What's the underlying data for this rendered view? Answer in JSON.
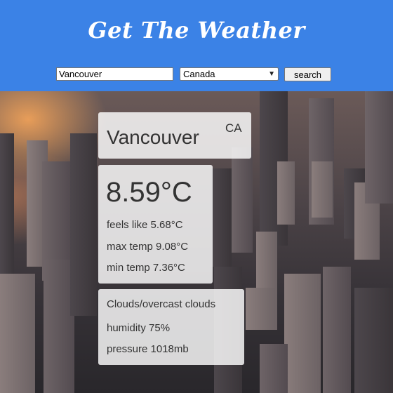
{
  "header": {
    "title": "Get The Weather",
    "background_color": "#3b82e6"
  },
  "search": {
    "city_value": "Vancouver",
    "country_selected": "Canada",
    "button_label": "search"
  },
  "weather": {
    "city": "Vancouver",
    "country_code": "CA",
    "temperature": "8.59°C",
    "feels_like": "feels like 5.68°C",
    "max_temp": "max temp 9.08°C",
    "min_temp": "min temp 7.36°C",
    "description": "Clouds/overcast clouds",
    "humidity": "humidity 75%",
    "pressure": "pressure 1018mb"
  },
  "background": {
    "icon": "city-skyline-photo"
  }
}
